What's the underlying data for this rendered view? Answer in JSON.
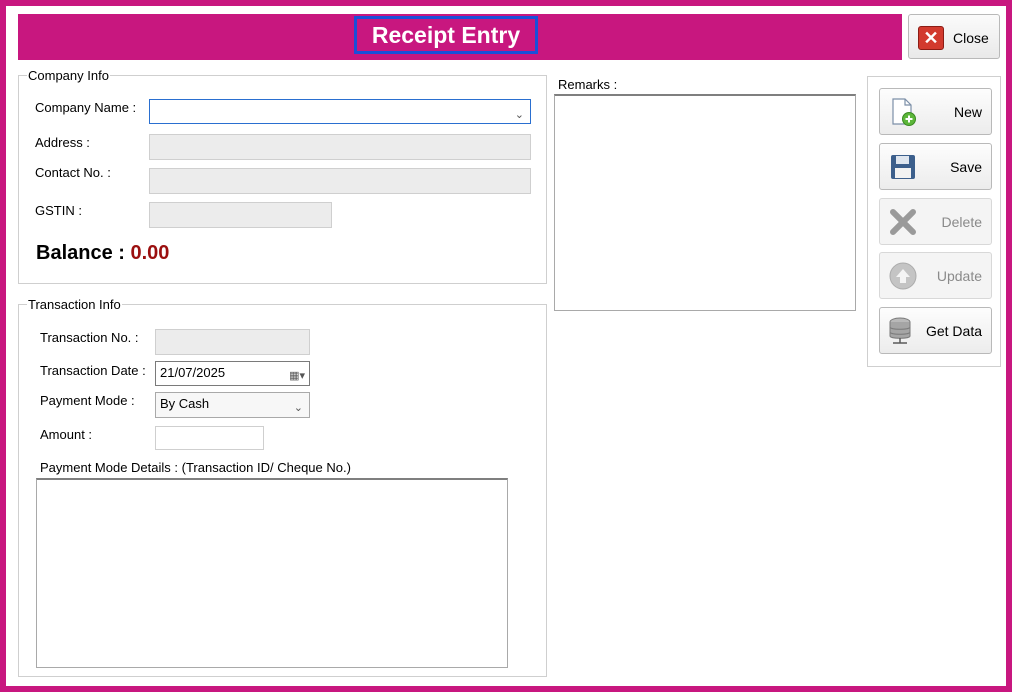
{
  "window": {
    "title": "Receipt Entry",
    "close_label": "Close"
  },
  "company_info": {
    "legend": "Company Info",
    "company_name_label": "Company Name :",
    "company_name_value": "",
    "address_label": "Address :",
    "contact_label": "Contact No. :",
    "gstin_label": "GSTIN :",
    "balance_label": "Balance :",
    "balance_value": "0.00"
  },
  "remarks": {
    "label": "Remarks :"
  },
  "transaction_info": {
    "legend": "Transaction Info",
    "transaction_no_label": "Transaction No. :",
    "transaction_date_label": "Transaction Date :",
    "transaction_date_value": "21/07/2025",
    "payment_mode_label": "Payment Mode :",
    "payment_mode_value": "By Cash",
    "amount_label": "Amount :",
    "details_label": "Payment Mode Details : (Transaction ID/ Cheque No.)"
  },
  "actions": {
    "new_label": "New",
    "save_label": "Save",
    "delete_label": "Delete",
    "update_label": "Update",
    "get_data_label": "Get Data"
  },
  "colors": {
    "frame": "#c8177f",
    "title_highlight": "#1a4fd8",
    "balance": "#9b0f0f"
  },
  "icons": {
    "close": "close-x-icon",
    "new": "new-document-icon",
    "save": "floppy-disk-icon",
    "delete": "delete-x-icon",
    "update": "up-arrow-icon",
    "get_data": "database-icon"
  }
}
